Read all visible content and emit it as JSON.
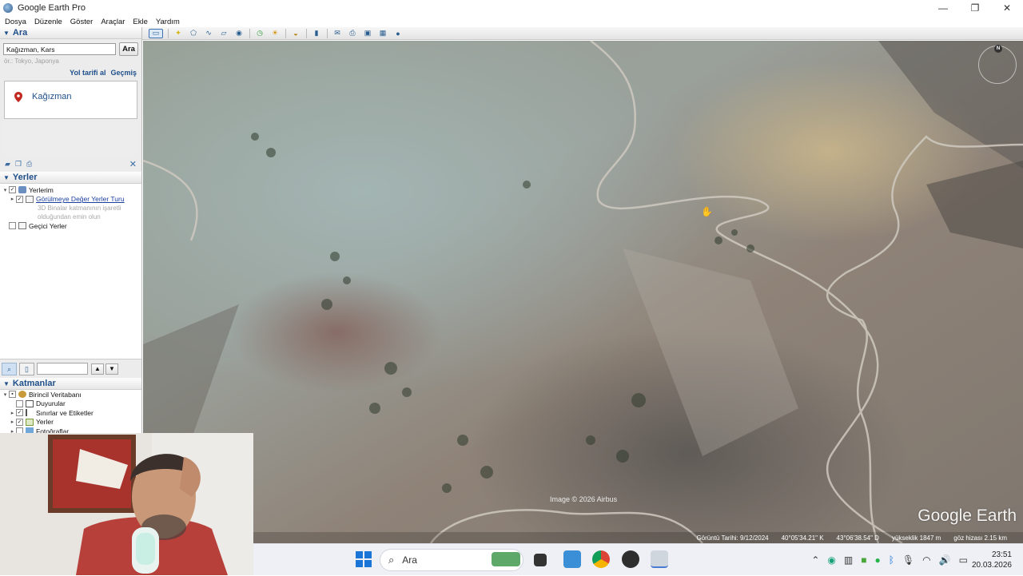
{
  "window": {
    "title": "Google Earth Pro",
    "controls": {
      "minimize": "—",
      "maximize": "❐",
      "close": "✕"
    }
  },
  "menu": [
    "Dosya",
    "Düzenle",
    "Göster",
    "Araçlar",
    "Ekle",
    "Yardım"
  ],
  "search_panel": {
    "header": "Ara",
    "input_value": "Kağızman, Kars",
    "button": "Ara",
    "hint": "ör.: Tokyo, Japonya",
    "links": {
      "directions": "Yol tarifi al",
      "history": "Geçmiş"
    },
    "result": "Kağızman"
  },
  "places_panel": {
    "header": "Yerler",
    "my_places": "Yerlerim",
    "tour": "Görülmeye Değer Yerler Turu",
    "tour_desc_1": "3D Binalar katmanının işaretli",
    "tour_desc_2": "olduğundan emin olun",
    "temp_places": "Geçici Yerler"
  },
  "layers_panel": {
    "header": "Katmanlar",
    "items": [
      "Birincil Veritabanı",
      "Duyurular",
      "Sınırlar ve Etiketler",
      "Yerler",
      "Fotoğraflar"
    ]
  },
  "map": {
    "watermark": "Google Earth",
    "credit": "Image © 2026 Airbus",
    "compass_n": "N",
    "status": {
      "imagery_date": "Görüntü Tarihi: 9/12/2024",
      "lat": "40°05'34.21\" K",
      "lon": "43°06'38.54\" D",
      "elevation": "yükseklik  1847 m",
      "eye_alt": "göz hizası   2.15 km"
    }
  },
  "taskbar": {
    "search_placeholder": "Ara",
    "time": "23:51",
    "date": "20.03.2026"
  }
}
